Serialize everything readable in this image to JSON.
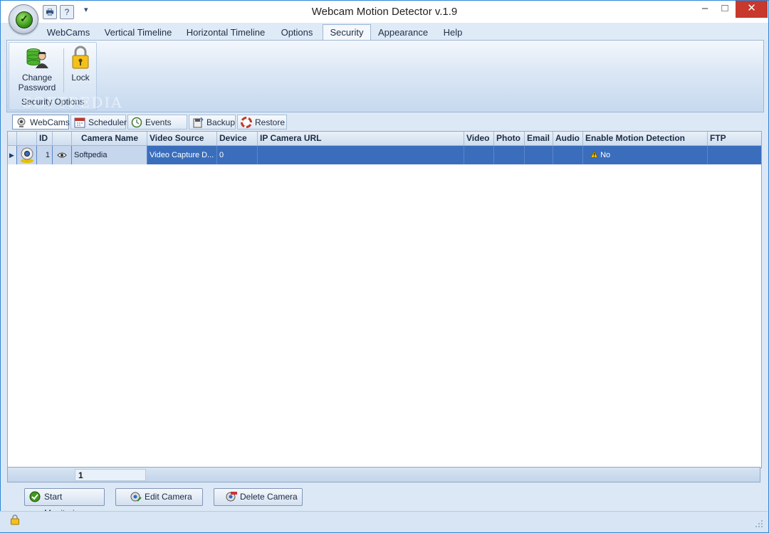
{
  "window": {
    "title": "Webcam Motion Detector v.1.9",
    "controls": {
      "minimize": "–",
      "maximize": "□",
      "close": "✕"
    }
  },
  "quick_access": [
    {
      "icon": "printer-icon",
      "glyph": "🖶"
    },
    {
      "icon": "help-icon",
      "glyph": "?"
    },
    {
      "icon": "customize-dropdown-icon",
      "glyph": "▾"
    }
  ],
  "ribbon": {
    "tabs": [
      "WebCams",
      "Vertical Timeline",
      "Horizontal Timeline",
      "Options",
      "Security",
      "Appearance",
      "Help"
    ],
    "active_tab": "Security",
    "group": {
      "label": "Security Options",
      "buttons": [
        {
          "label_line1": "Change",
          "label_line2": "Password",
          "icon": "change-password-icon"
        },
        {
          "label_line1": "Lock",
          "icon": "lock-icon"
        }
      ]
    }
  },
  "watermark": "SOFTPEDIA",
  "subtabs": [
    {
      "label": "WebCams",
      "icon": "webcam-icon",
      "active": true
    },
    {
      "label": "Scheduler",
      "icon": "calendar-icon",
      "active": false
    },
    {
      "label": "Events List",
      "icon": "clock-icon",
      "active": false
    },
    {
      "label": "Backup",
      "icon": "backup-icon",
      "active": false
    },
    {
      "label": "Restore",
      "icon": "restore-lifebuoy-icon",
      "active": false
    }
  ],
  "grid": {
    "columns": [
      "ID",
      "Camera Name",
      "Video Source",
      "Device",
      "IP Camera URL",
      "Video",
      "Photo",
      "Email",
      "Audio",
      "Enable Motion Detection",
      "FTP"
    ],
    "rows": [
      {
        "id": "1",
        "camera_name": "Softpedia",
        "video_source": "Video Capture D...",
        "device": "0",
        "ip_camera_url": "",
        "video": "",
        "photo": "",
        "email": "",
        "audio": "",
        "enable_motion_detection": "No",
        "ftp": ""
      }
    ],
    "footer_count": "1"
  },
  "buttons": {
    "start_monitoring": "Start Monitoring",
    "edit_camera": "Edit Camera",
    "delete_camera": "Delete Camera"
  },
  "colors": {
    "selected_row": "#3a6ebc",
    "accent_frame": "#2e86d6",
    "close_button": "#c7392d"
  }
}
